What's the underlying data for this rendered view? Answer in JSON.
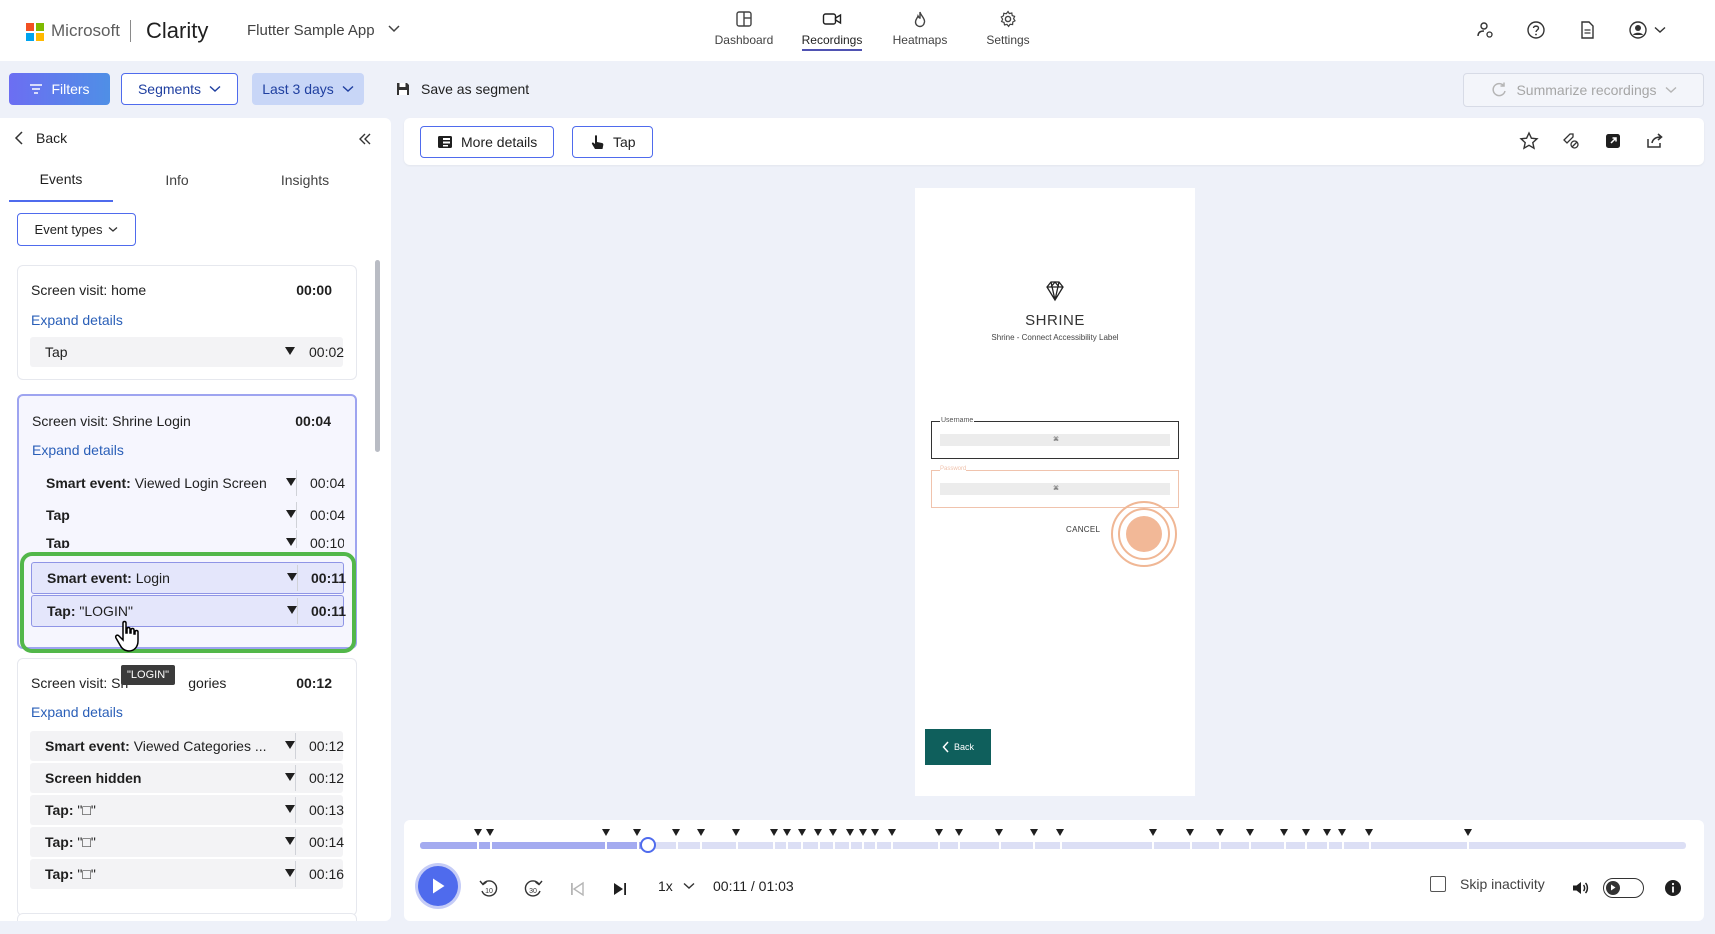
{
  "header": {
    "ms_text": "Microsoft",
    "brand": "Clarity",
    "project": "Flutter Sample App",
    "nav": [
      {
        "label": "Dashboard",
        "icon": "dashboard-icon"
      },
      {
        "label": "Recordings",
        "icon": "video-icon",
        "active": true
      },
      {
        "label": "Heatmaps",
        "icon": "flame-icon"
      },
      {
        "label": "Settings",
        "icon": "gear-icon"
      }
    ],
    "ms_colors": [
      "#f25022",
      "#7fba00",
      "#00a4ef",
      "#ffb900"
    ]
  },
  "toolbar": {
    "filters": "Filters",
    "segments": "Segments",
    "date_range": "Last 3 days",
    "save_segment": "Save as segment",
    "summarize": "Summarize recordings"
  },
  "left": {
    "back": "Back",
    "tabs": [
      "Events",
      "Info",
      "Insights"
    ],
    "event_types": "Event types",
    "cards": [
      {
        "title": "Screen visit: home",
        "time": "00:00",
        "expand": "Expand details",
        "rows": [
          {
            "label": "Tap",
            "time": "00:02"
          }
        ]
      },
      {
        "title": "Screen visit: Shrine Login",
        "time": "00:04",
        "expand": "Expand details",
        "rows": [
          {
            "bold": "Smart event:",
            "label": " Viewed Login Screen",
            "time": "00:04"
          },
          {
            "label": "Tap",
            "time": "00:04"
          },
          {
            "label": "Tap",
            "time": "00:10"
          },
          {
            "bold": "Smart event:",
            "label": " Login",
            "time": "00:11"
          },
          {
            "bold": "Tap:",
            "label": " \"LOGIN\"",
            "time": "00:11"
          }
        ]
      },
      {
        "title": "Screen visit: Sh",
        "title_tail": "gories",
        "time": "00:12",
        "expand": "Expand details",
        "rows": [
          {
            "bold": "Smart event:",
            "label": " Viewed Categories ...",
            "time": "00:12"
          },
          {
            "label": "Screen hidden",
            "time": "00:12"
          },
          {
            "bold": "Tap:",
            "label": " \"□\"",
            "time": "00:13"
          },
          {
            "bold": "Tap:",
            "label": " \"□\"",
            "time": "00:14"
          },
          {
            "bold": "Tap:",
            "label": " \"□\"",
            "time": "00:16"
          }
        ]
      }
    ],
    "tooltip": "\"LOGIN\""
  },
  "viewer": {
    "more_details": "More details",
    "tap": "Tap",
    "phone": {
      "title": "SHRINE",
      "subtitle": "Shrine - Connect Accessibility Label",
      "username_label": "Username",
      "password_label": "Password",
      "key_glyph": "⌘",
      "cancel": "CANCEL",
      "back": "Back"
    }
  },
  "player": {
    "speed": "1x",
    "time": "00:11 / 01:03",
    "progress": 0.18,
    "skip_inactivity": "Skip inactivity",
    "markers": [
      0.046,
      0.056,
      0.147,
      0.172,
      0.203,
      0.222,
      0.25,
      0.28,
      0.29,
      0.302,
      0.315,
      0.327,
      0.34,
      0.35,
      0.36,
      0.373,
      0.41,
      0.426,
      0.458,
      0.485,
      0.506,
      0.579,
      0.609,
      0.632,
      0.656,
      0.683,
      0.7,
      0.717,
      0.729,
      0.75,
      0.828
    ]
  }
}
